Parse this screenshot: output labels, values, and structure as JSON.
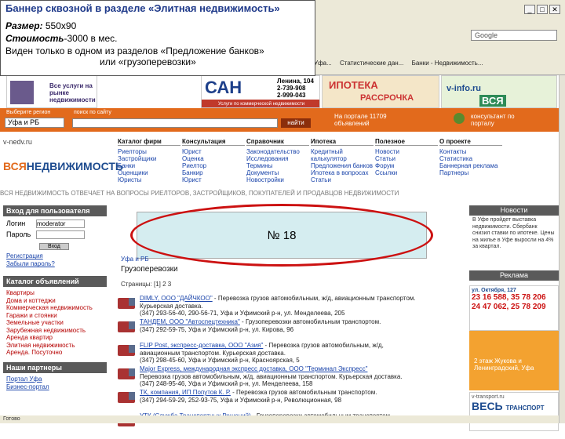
{
  "note": {
    "title": "Баннер сквозной в разделе «Элитная недвижимость»",
    "size_label": "Размер:",
    "size_value": "550х90",
    "price_label": "Стоимость",
    "price_value": "-3000 в мес.",
    "visible_text": "Виден только в одном из разделов «Предложение банков»",
    "visible_text2": "или «грузоперевозки»"
  },
  "browser": {
    "search_placeholder": "Google",
    "bookmarks": [
      "Уфа...",
      "Статистические дан...",
      "Банки - Недвижимость..."
    ],
    "win_controls": [
      "_",
      "□",
      "✕"
    ]
  },
  "banners": {
    "services": "Все услуги на рынке недвижимости",
    "san": "САН",
    "san_address": "Ленина, 104",
    "san_phone1": "2-739-908",
    "san_phone2": "2-999-043",
    "san_sub": "Услуги по коммерческой недвижимости",
    "ipoteka1": "ИПОТЕКА",
    "ipoteka2": "РАССРОЧКА",
    "vinfo": "v-info.ru",
    "vinfo_sub": "ВСЯ"
  },
  "searchbar": {
    "region_label": "Выберите регион",
    "region_value": "Уфа и РБ",
    "search_label": "поиск по сайту",
    "find_button": "найти",
    "ads_count": "На портале 11709 объявлений",
    "consult": "консультант по порталу"
  },
  "logo": {
    "url": "v-nedv.ru",
    "name_a": "ВСЯ",
    "name_b": "НЕДВИЖИМОСТЬ"
  },
  "menu": [
    {
      "head": "Каталог фирм",
      "items": [
        "Риелторы",
        "Застройщики",
        "Банки",
        "Оценщики",
        "Юристы"
      ]
    },
    {
      "head": "Консультация",
      "items": [
        "Юрист",
        "Оценка",
        "Риелтор",
        "Банкир",
        "Юрист"
      ]
    },
    {
      "head": "Справочник",
      "items": [
        "Законодательство",
        "Исследования",
        "Термины",
        "Документы",
        "Новостройки"
      ]
    },
    {
      "head": "Ипотека",
      "items": [
        "Кредитный калькулятор",
        "Предложения банков",
        "Ипотека в вопросах",
        "Статьи"
      ]
    },
    {
      "head": "Полезное",
      "items": [
        "Новости",
        "Статьи",
        "Форум",
        "Ссылки"
      ]
    },
    {
      "head": "О проекте",
      "items": [
        "Контакты",
        "Статистика",
        "Баннерная реклама",
        "Партнеры"
      ]
    }
  ],
  "marquee": "ВСЯ НЕДВИЖИМОСТЬ ОТВЕЧАЕТ НА ВОПРОСЫ РИЕЛТОРОВ, ЗАСТРОЙЩИКОВ, ПОКУПАТЕЛЕЙ И ПРОДАВЦОВ НЕДВИЖИМОСТИ",
  "left": {
    "login_head": "Вход для пользователя",
    "login_label": "Логин",
    "login_value": "moderator",
    "password_label": "Пароль",
    "login_button": "Вход",
    "register": "Регистрация",
    "forgot": "Забыли пароль?",
    "catalog_head": "Каталог объявлений",
    "categories": [
      "Квартиры",
      "Дома и коттеджи",
      "Коммерческая недвижимость",
      "Гаражи и стоянки",
      "Земельные участки",
      "Зарубежная недвижимость",
      "Аренда квартир",
      "Элитная недвижимость",
      "Аренда. Посуточно"
    ],
    "partners_head": "Наши партнеры",
    "partners": [
      "Портал Уфа",
      "Бизнес-портал"
    ]
  },
  "content": {
    "marker": "№ 18",
    "crumb": "Уфа и РБ",
    "section_title": "Грузоперевозки",
    "pager": "Страницы: [1] 2 3",
    "listings": [
      {
        "name": "DIMLY, ООО \"ДАЙЧКОО\"",
        "text": " - Перевозка грузов автомобильным, ж/д, авиационным транспортом.",
        "line2": "Курьерская доставка.",
        "line3": "(347) 293-56-40, 290-56-71, Уфа и Уфимский р-н, ул. Менделеева, 205"
      },
      {
        "name": "ТАНДЕМ, ООО \"Автоспецтехника\"",
        "text": " - Грузоперевозки автомобильным транспортом.",
        "line2": "",
        "line3": "(347) 292-59-75, Уфа и Уфимский р-н, ул. Кирова, 96"
      },
      {
        "name": "FLIP Post, экспресс-доставка, ООО \"Азия\"",
        "text": " - Перевозка грузов автомобильным, ж/д,",
        "line2": "авиационным транспортом. Курьерская доставка.",
        "line3": "(347) 298-45-60, Уфа и Уфимский р-н, Красноярская, 5"
      },
      {
        "name": "Major Express, международная экспресс доставка, ООО \"Терминал Экспресс\"",
        "text": "",
        "line2": "Перевозка грузов автомобильным, ж/д, авиационным транспортом. Курьерская доставка.",
        "line3": "(347) 248-95-46, Уфа и Уфимский р-н, ул. Менделеева, 158"
      },
      {
        "name": "ТК, компания, ИП Попутов К. Р.",
        "text": " - Перевозка грузов автомобильным транспортом.",
        "line2": "",
        "line3": "(347) 294-59-29, 252-93-75, Уфа и Уфимский р-н, Революционная, 98"
      },
      {
        "name": "УТК (Служба Транспортных Решений)",
        "text": " - Грузоперевозки автомобильным транспортом.",
        "line2": "",
        "line3": ""
      }
    ]
  },
  "right": {
    "news_head": "Новости",
    "news_text": "В Уфе пройдет выставка недвижимости. Сбербанк снизил ставки по ипотеке. Цены на жилье в Уфе выросли на 4% за квартал.",
    "ads_head": "Реклама",
    "addr": "ул. Октября, 127",
    "phones": [
      "23 16 588, 35 78 206",
      "24 47 062, 25 78 209"
    ],
    "orange_ad": "2 этаж Жукова и Ленинградский, Уфа",
    "vest_url": "v-transport.ru",
    "vest_big": "ВЕСЬ",
    "vest_sub": "ТРАНСПОРТ"
  },
  "status": "Готово"
}
